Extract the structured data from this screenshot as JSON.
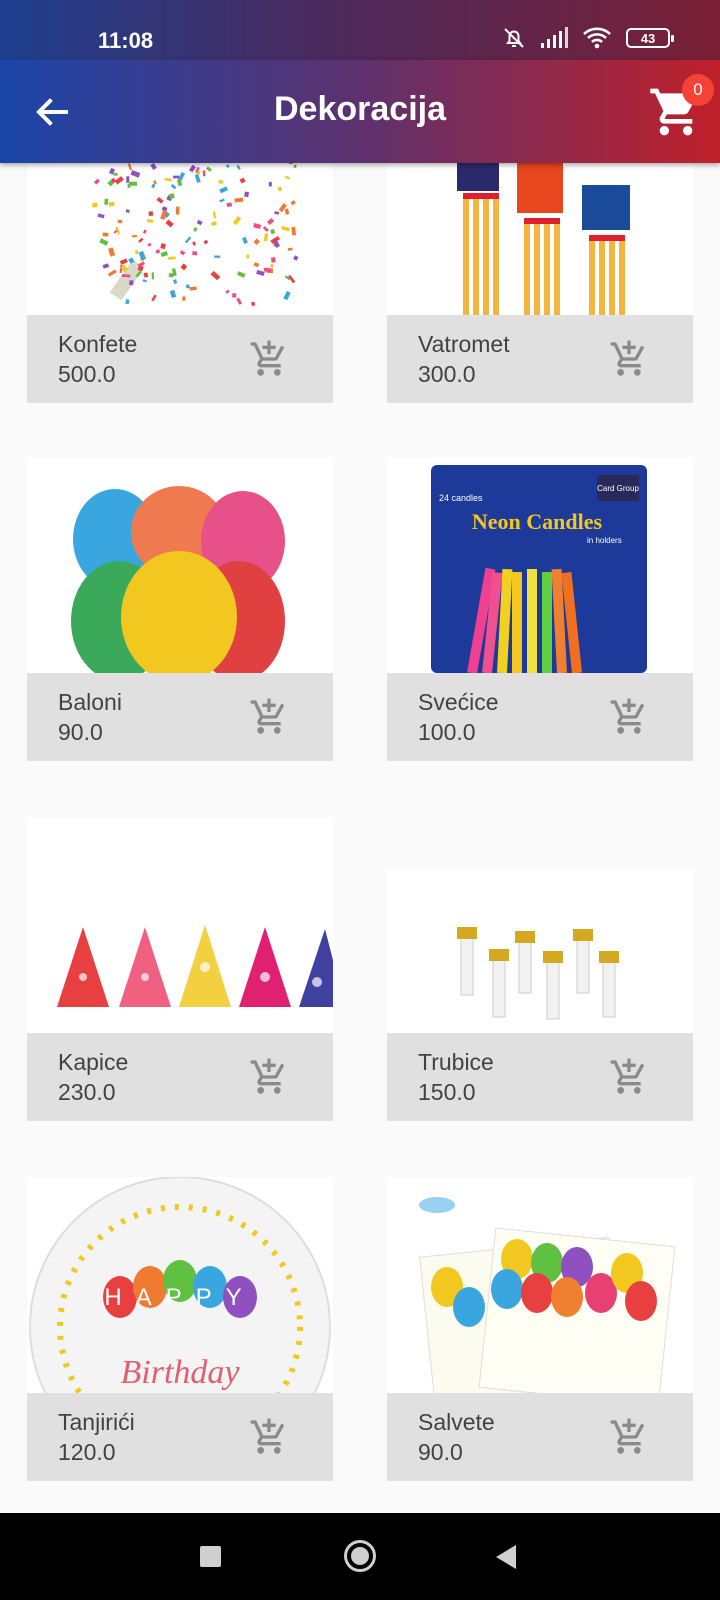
{
  "status_bar": {
    "time": "11:08",
    "battery": "43"
  },
  "app_bar": {
    "title": "Dekoracija",
    "cart_count": "0"
  },
  "products": [
    {
      "name": "Konfete",
      "price": "500.0"
    },
    {
      "name": "Vatromet",
      "price": "300.0"
    },
    {
      "name": "Baloni",
      "price": "90.0"
    },
    {
      "name": "Svećice",
      "price": "100.0"
    },
    {
      "name": "Kapice",
      "price": "230.0"
    },
    {
      "name": "Trubice",
      "price": "150.0"
    },
    {
      "name": "Tanjirići",
      "price": "120.0"
    },
    {
      "name": "Salvete",
      "price": "90.0"
    }
  ],
  "images": {
    "candles_brand": "Card Group",
    "candles_count": "24 candles",
    "candles_title": "Neon Candles",
    "candles_sub": "in holders",
    "plate_top": "HAPPY",
    "plate_bottom": "Birthday"
  },
  "colors": {
    "accent_red": "#f44336",
    "card_info_bg": "#e0e0e0"
  }
}
